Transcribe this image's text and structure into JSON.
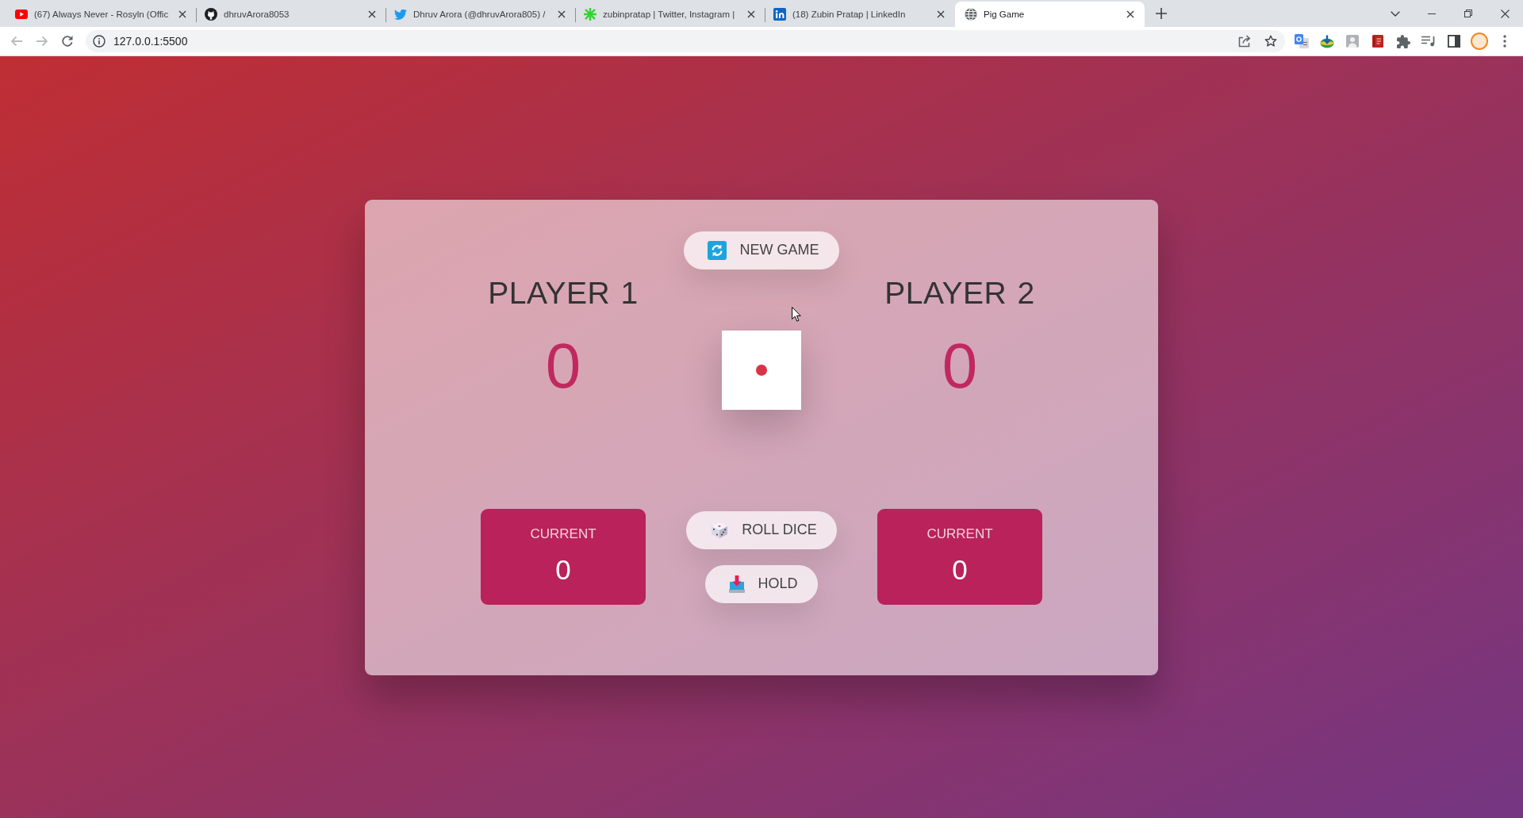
{
  "browser": {
    "tabs": [
      {
        "kind": "video",
        "title": "(67) Always Never - Rosyln (Offic",
        "selected": false
      },
      {
        "kind": "cat",
        "title": "dhruvArora8053",
        "selected": false
      },
      {
        "kind": "bird",
        "title": "Dhruv Arora (@dhruvArora805) /",
        "selected": false
      },
      {
        "kind": "sprite",
        "title": "zubinpratap | Twitter, Instagram |",
        "selected": false
      },
      {
        "kind": "tile",
        "title": "(18) Zubin Pratap | LinkedIn",
        "selected": false
      },
      {
        "kind": "globe",
        "title": "Pig Game",
        "selected": true
      }
    ],
    "toolbar": {
      "back": {
        "disabled": true
      },
      "forward": {
        "disabled": true
      },
      "url": "127.0.0.1:5500"
    }
  },
  "game": {
    "new_game_button": {
      "label": "NEW GAME"
    },
    "players": [
      {
        "name": "PLAYER 1",
        "score": "0",
        "current_label": "CURRENT",
        "current_score": "0"
      },
      {
        "name": "PLAYER 2",
        "score": "0",
        "current_label": "CURRENT",
        "current_score": "0"
      }
    ],
    "dice": {
      "kind": "one"
    },
    "roll_button": {
      "label": "ROLL DICE"
    },
    "hold_button": {
      "label": "HOLD"
    }
  }
}
